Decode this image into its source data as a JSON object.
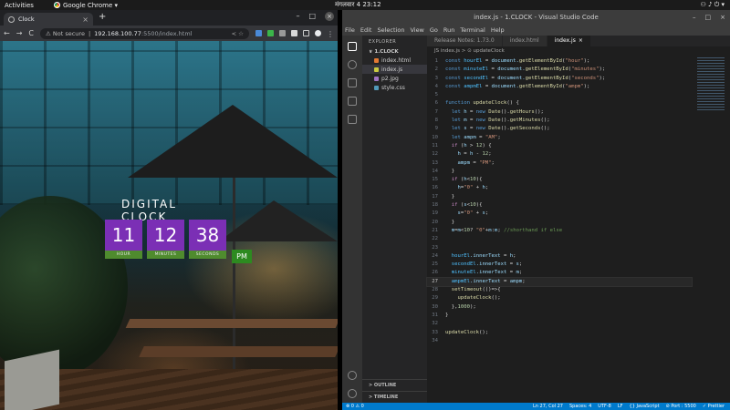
{
  "topbar": {
    "activities": "Activities",
    "app": "Google Chrome ▾",
    "datetime": "मंगलवार 4 23:12",
    "tray": "⚇  ♪  ⏻ ▾"
  },
  "chrome": {
    "tab_title": "Clock",
    "new_tab": "+",
    "nav": {
      "back": "←",
      "forward": "→",
      "reload": "C"
    },
    "security": "⚠ Not secure",
    "url_host": "192.168.100.77",
    "url_path": ":5500/index.html",
    "omni_icons": "<  ☆"
  },
  "clock": {
    "title": "DIGITAL CLOCK",
    "hour": "11",
    "minutes": "12",
    "seconds": "38",
    "ampm": "PM",
    "hour_label": "HOUR",
    "minutes_label": "MINUTES",
    "seconds_label": "SECONDS"
  },
  "vscode": {
    "title": "index.js - 1.CLOCK - Visual Studio Code",
    "menu": [
      "File",
      "Edit",
      "Selection",
      "View",
      "Go",
      "Run",
      "Terminal",
      "Help"
    ],
    "explorer_title": "EXPLORER",
    "folder": "∨ 1.CLOCK",
    "files": [
      {
        "name": "index.html",
        "color": "#e37933"
      },
      {
        "name": "index.js",
        "color": "#cbcb41"
      },
      {
        "name": "p2.jpg",
        "color": "#a074c4"
      },
      {
        "name": "style.css",
        "color": "#519aba"
      }
    ],
    "outline": "> OUTLINE",
    "timeline": "> TIMELINE",
    "tabs": [
      "Release Notes: 1.73.0",
      "index.html",
      "index.js"
    ],
    "breadcrumb": "JS index.js > ⊙ updateClock",
    "status_left": [
      "⊗ 0 ⚠ 0"
    ],
    "status_right": [
      "Ln 27, Col 27",
      "Spaces: 4",
      "UTF-8",
      "LF",
      "{} JavaScript",
      "⊘ Port : 5500",
      "✓ Prettier"
    ]
  }
}
